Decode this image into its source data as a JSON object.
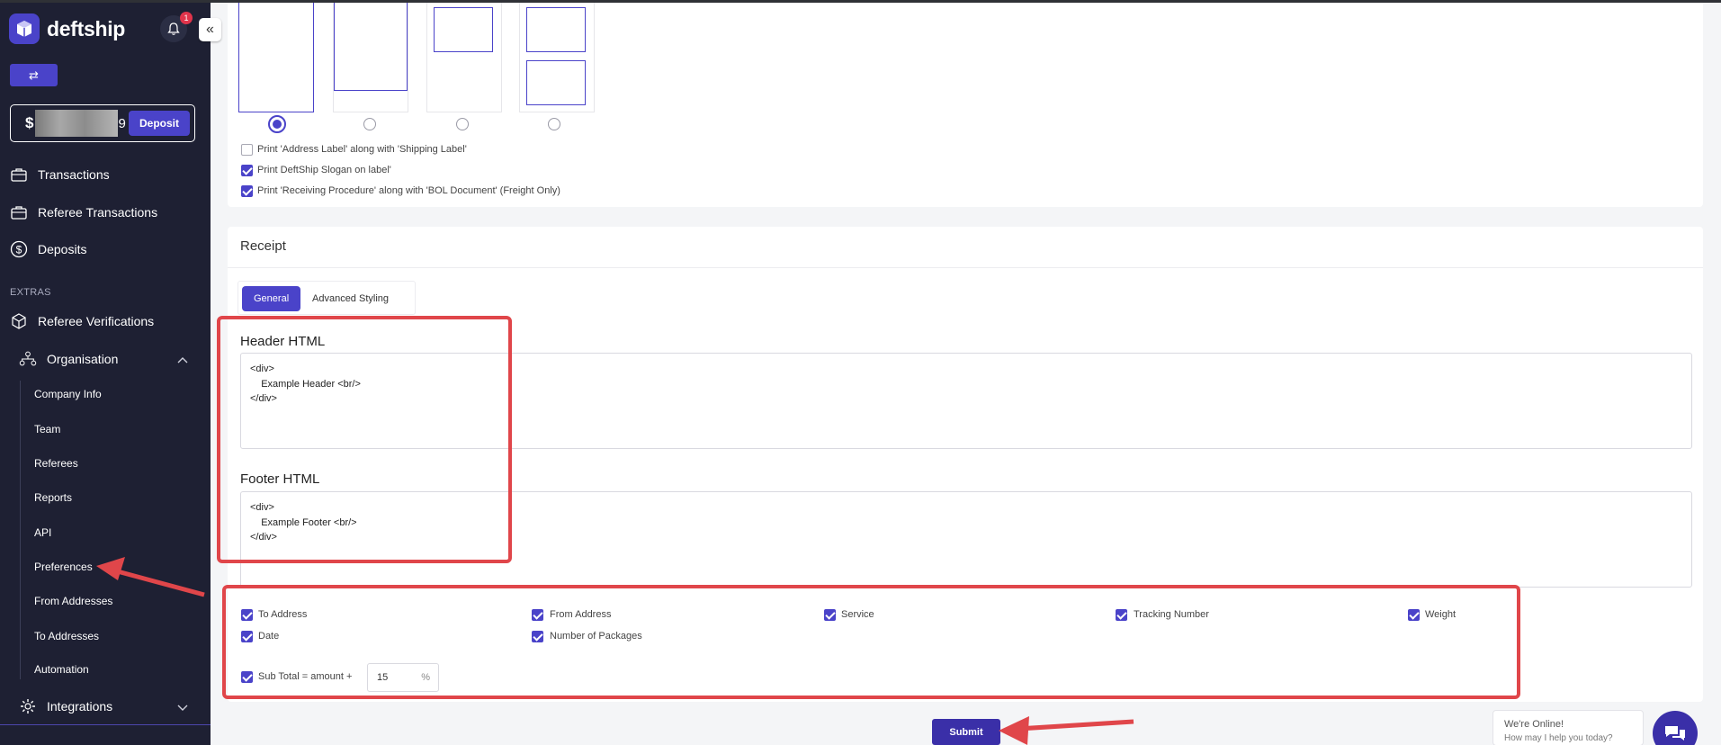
{
  "app": {
    "brand_name": "deftship",
    "notification_count": "1",
    "balance_prefix": "$",
    "balance_tail": "9",
    "deposit_label": "Deposit"
  },
  "sidebar": {
    "items": [
      {
        "label": "Transactions",
        "icon": "briefcase-icon"
      },
      {
        "label": "Referee Transactions",
        "icon": "briefcase-icon"
      },
      {
        "label": "Deposits",
        "icon": "dollar-circle-icon"
      }
    ],
    "extras_heading": "EXTRAS",
    "extras_items": [
      {
        "label": "Referee Verifications",
        "icon": "cube-icon"
      },
      {
        "label": "Organisation",
        "icon": "org-chart-icon",
        "expanded": true
      }
    ],
    "organisation_subitems": [
      "Company Info",
      "Team",
      "Referees",
      "Reports",
      "API",
      "Preferences",
      "From Addresses",
      "To Addresses",
      "Automation"
    ],
    "integrations_label": "Integrations"
  },
  "label_settings": {
    "selected_layout_index": 0,
    "checkboxes": [
      {
        "label": "Print 'Address Label' along with 'Shipping Label'",
        "checked": false
      },
      {
        "label": "Print DeftShip Slogan on label'",
        "checked": true
      },
      {
        "label": "Print 'Receiving Procedure' along with 'BOL Document' (Freight Only)",
        "checked": true
      }
    ]
  },
  "receipt": {
    "title": "Receipt",
    "tabs": {
      "general": "General",
      "advanced": "Advanced Styling"
    },
    "header_label": "Header HTML",
    "header_value": "<div>\n    Example Header <br/>\n</div>",
    "footer_label": "Footer HTML",
    "footer_value": "<div>\n    Example Footer <br/>\n</div>",
    "options": [
      {
        "label": "To Address",
        "checked": true
      },
      {
        "label": "From Address",
        "checked": true
      },
      {
        "label": "Service",
        "checked": true
      },
      {
        "label": "Tracking Number",
        "checked": true
      },
      {
        "label": "Weight",
        "checked": true
      },
      {
        "label": "Date",
        "checked": true
      },
      {
        "label": "Number of Packages",
        "checked": true
      }
    ],
    "subtotal_label": "Sub Total = amount +",
    "subtotal_checked": true,
    "subtotal_value": "15",
    "subtotal_unit": "%",
    "submit_label": "Submit"
  },
  "chat": {
    "line1": "We're Online!",
    "line2": "How may I help you today?"
  },
  "colors": {
    "sidebar_bg": "#1e2033",
    "accent": "#4a43c9",
    "annotation": "#e0464a"
  }
}
